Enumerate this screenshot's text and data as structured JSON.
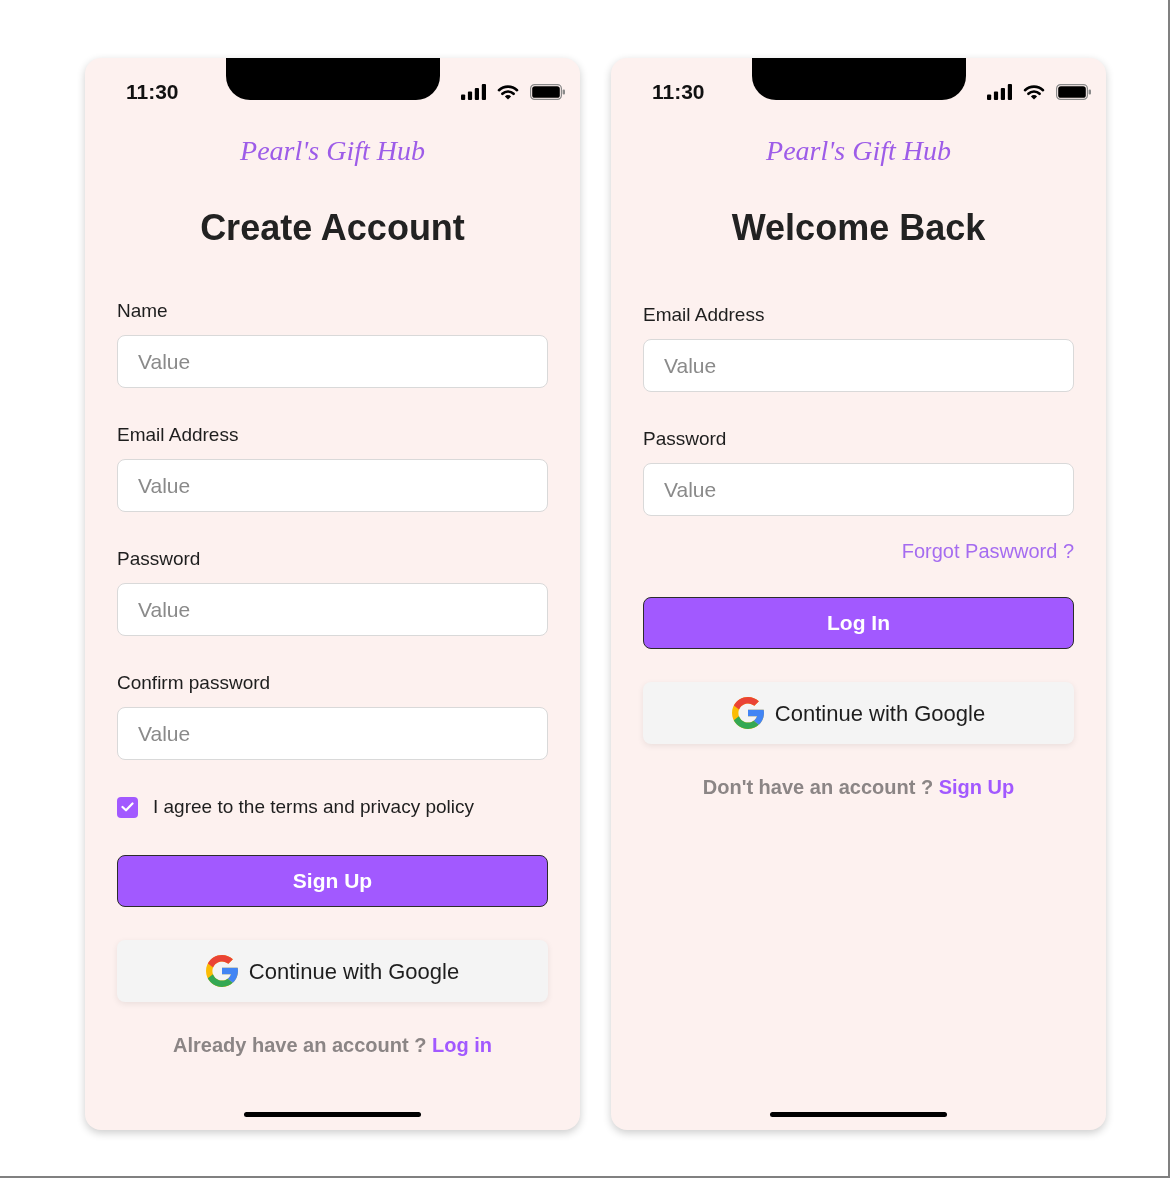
{
  "screens": [
    {
      "status_bar": {
        "time": "11:30"
      },
      "logo": "Pearl's Gift Hub",
      "title": "Create Account",
      "fields": [
        {
          "label": "Name",
          "placeholder": "Value"
        },
        {
          "label": "Email Address",
          "placeholder": "Value"
        },
        {
          "label": "Password",
          "placeholder": "Value"
        },
        {
          "label": "Confirm password",
          "placeholder": "Value"
        }
      ],
      "terms": {
        "label": "I agree to the terms and privacy policy",
        "checked": true
      },
      "primary_button": "Sign Up",
      "google_button": "Continue with Google",
      "footer": {
        "text": "Already have an account ?",
        "link": "Log in"
      }
    },
    {
      "status_bar": {
        "time": "11:30"
      },
      "logo": "Pearl's Gift Hub",
      "title": "Welcome Back",
      "fields": [
        {
          "label": "Email Address",
          "placeholder": "Value"
        },
        {
          "label": "Password",
          "placeholder": "Value"
        }
      ],
      "forgot_link": "Forgot Paswword ?",
      "primary_button": "Log In",
      "google_button": "Continue with Google",
      "footer": {
        "text": "Don't have an account ?",
        "link": "Sign Up"
      }
    }
  ]
}
